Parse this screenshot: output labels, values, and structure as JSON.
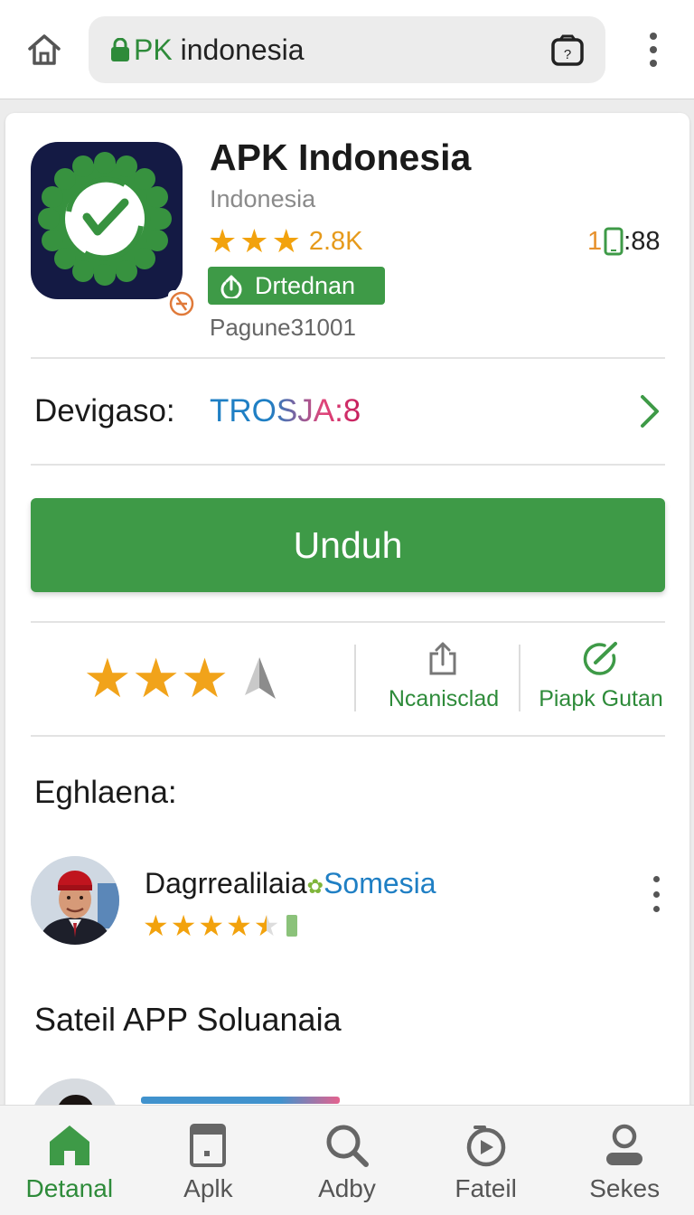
{
  "browser": {
    "url_prefix": "PK",
    "url_rest": " indonesia",
    "icons": [
      "home-icon",
      "lock-icon",
      "tabs-icon",
      "more-vert-icon"
    ]
  },
  "app": {
    "title": "APK Indonesia",
    "region": "Indonesia",
    "rating_stars": 3,
    "rating_count": "2.8K",
    "install_badge_label": "Drtednan",
    "package_id": "Pagune31001",
    "size_prefix": "1",
    "size_value": ":88"
  },
  "developer": {
    "label": "Devigaso:",
    "value": "TROSJA:8"
  },
  "download_button_label": "Unduh",
  "actions": {
    "rating_stars": 3,
    "items": [
      {
        "label": "Ncanisclad",
        "icon": "share-icon"
      },
      {
        "label": "Piapk Gutan",
        "icon": "edit-check-icon"
      }
    ]
  },
  "reviews": {
    "title": "Eghlaena:",
    "items": [
      {
        "name": "Dagrrealilaia",
        "location": "Somesia",
        "stars": 4.5
      }
    ]
  },
  "similar": {
    "title": "Sateil APP Soluanaia"
  },
  "nav": {
    "items": [
      {
        "label": "Detanal",
        "icon": "home-icon",
        "active": true
      },
      {
        "label": "Aplk",
        "icon": "apps-icon",
        "active": false
      },
      {
        "label": "Adby",
        "icon": "search-icon",
        "active": false
      },
      {
        "label": "Fateil",
        "icon": "history-icon",
        "active": false
      },
      {
        "label": "Sekes",
        "icon": "profile-icon",
        "active": false
      }
    ]
  },
  "colors": {
    "brand_green": "#3e9a47",
    "star": "#f2a20d",
    "link_blue": "#1f7fc4",
    "icon_navy": "#141a44"
  }
}
